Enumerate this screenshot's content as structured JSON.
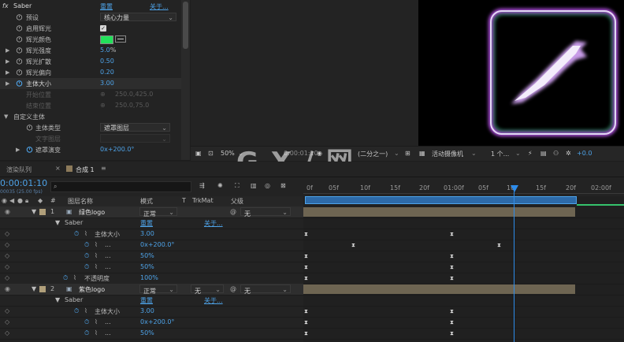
{
  "effect_controls": {
    "effect_name": "Saber",
    "reset": "重置",
    "about": "关于...",
    "props": [
      {
        "label": "预设",
        "value": "核心力量",
        "type": "dropdown"
      },
      {
        "label": "启用辉光",
        "value": "",
        "type": "checkbox",
        "checked": true
      },
      {
        "label": "辉光颜色",
        "value": "",
        "type": "color",
        "color": "#22e15a"
      },
      {
        "label": "辉光强度",
        "value": "5.0",
        "unit": "%",
        "type": "number"
      },
      {
        "label": "辉光扩散",
        "value": "0.50",
        "type": "number"
      },
      {
        "label": "辉光偏向",
        "value": "0.20",
        "type": "number"
      },
      {
        "label": "主体大小",
        "value": "3.00",
        "type": "number",
        "keyframed": true
      },
      {
        "label": "开始位置",
        "value": "250.0,425.0",
        "type": "point",
        "disabled": true
      },
      {
        "label": "结束位置",
        "value": "250.0,75.0",
        "type": "point",
        "disabled": true
      }
    ],
    "group_label": "自定义主体",
    "group_props": [
      {
        "label": "主体类型",
        "value": "遮罩图层",
        "type": "dropdown"
      },
      {
        "label": "文字图层",
        "value": "",
        "type": "dropdown",
        "disabled": true
      },
      {
        "label": "遮罩演变",
        "value": "0x+200.0°",
        "type": "number"
      }
    ]
  },
  "viewer": {
    "zoom": "50%",
    "timecode": "0:00:01:10",
    "resolution": "(二分之一)",
    "camera": "活动摄像机",
    "views": "1 个...",
    "exposure": "+0.0"
  },
  "timeline": {
    "tabs": [
      "渲染队列",
      "合成 1"
    ],
    "timecode": "0:00:01:10",
    "fps": "00035 (25.00 fps)",
    "search_placeholder": "",
    "columns": [
      "#",
      "图层名称",
      "模式",
      "T",
      "TrkMat",
      "父级"
    ],
    "ruler": [
      "0f",
      "05f",
      "10f",
      "15f",
      "20f",
      "01:00f",
      "05f",
      "10f",
      "15f",
      "20f",
      "02:00f"
    ],
    "rows": [
      {
        "kind": "layer",
        "index": "1",
        "name": "绿色logo",
        "mode": "正常",
        "trkmat": "",
        "parent": "无"
      },
      {
        "kind": "effect",
        "name": "Saber",
        "reset": "重置",
        "about": "关于..."
      },
      {
        "kind": "prop",
        "name": "主体大小",
        "value": "3.00"
      },
      {
        "kind": "prop",
        "name": "...",
        "value": "0x+200.0°"
      },
      {
        "kind": "prop",
        "name": "...",
        "value": "50%"
      },
      {
        "kind": "prop",
        "name": "...",
        "value": "50%"
      },
      {
        "kind": "prop",
        "name": "不透明度",
        "value": "100%"
      },
      {
        "kind": "layer",
        "index": "2",
        "name": "紫色logo",
        "mode": "正常",
        "trkmat": "无",
        "parent": "无"
      },
      {
        "kind": "effect",
        "name": "Saber",
        "reset": "重置",
        "about": "关于..."
      },
      {
        "kind": "prop",
        "name": "主体大小",
        "value": "3.00"
      },
      {
        "kind": "prop",
        "name": "...",
        "value": "0x+200.0°"
      },
      {
        "kind": "prop",
        "name": "...",
        "value": "50%"
      }
    ]
  },
  "watermark": "G X / 网",
  "colors": {
    "accent": "#4ea3e8",
    "playhead": "#2d8ceb",
    "glow_green": "#22e15a"
  }
}
